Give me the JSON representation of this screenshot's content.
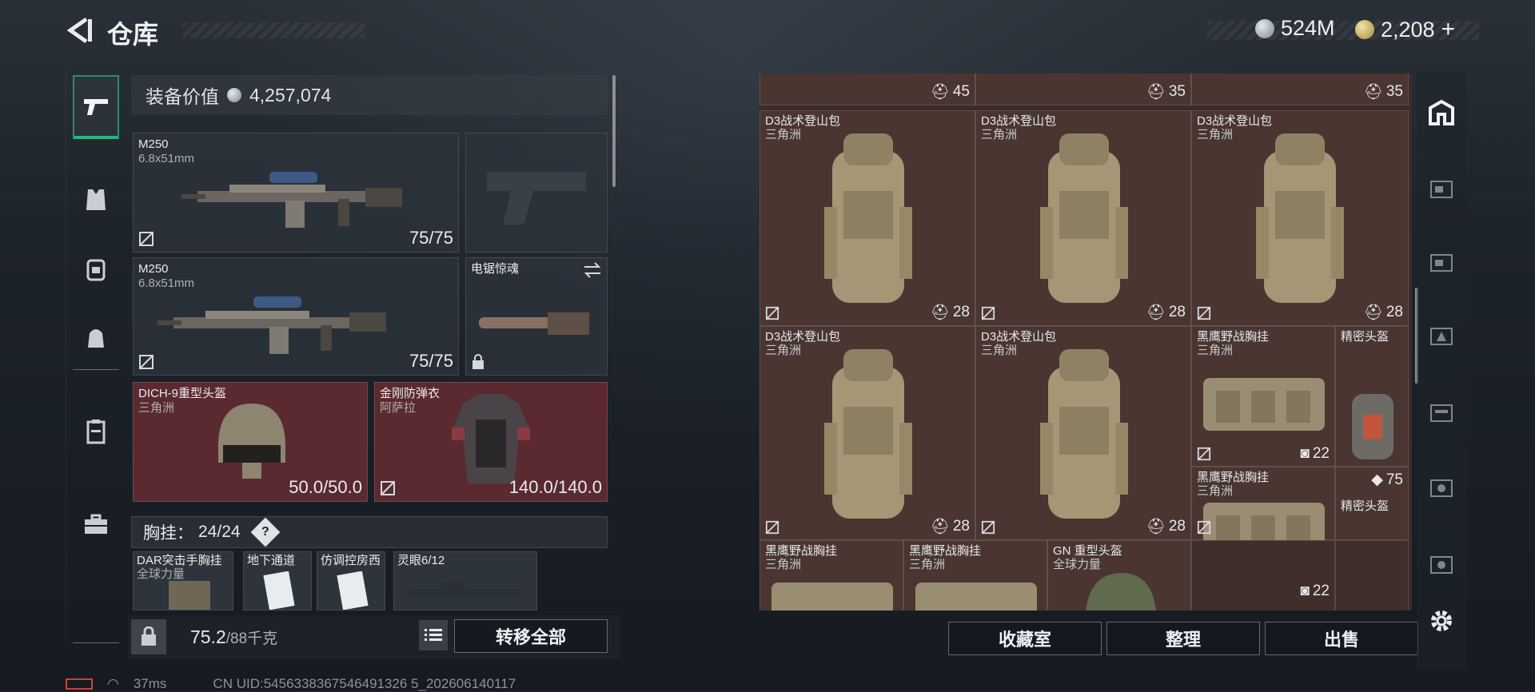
{
  "header": {
    "title": "仓库",
    "currency1": "524M",
    "currency2": "2,208"
  },
  "left_nav": {
    "items": [
      "weapon",
      "vest",
      "backpack",
      "bag",
      "armor",
      "toolbox"
    ],
    "active": "weapon"
  },
  "equipment": {
    "value_label": "装备价值",
    "value": "4,257,074",
    "primary1": {
      "name": "M250",
      "caliber": "6.8x51mm",
      "durability": "75/75"
    },
    "primary2": {
      "name": "M250",
      "caliber": "6.8x51mm",
      "durability": "75/75"
    },
    "melee": {
      "name": "电锯惊魂"
    },
    "helmet": {
      "name": "DICH-9重型头盔",
      "origin": "三角洲",
      "durability": "50.0/50.0"
    },
    "armor": {
      "name": "金刚防弹衣",
      "origin": "阿萨拉",
      "durability": "140.0/140.0"
    },
    "chest": {
      "label": "胸挂：",
      "count": "24/24",
      "help": "?"
    },
    "minis": [
      {
        "name": "DAR突击手胸挂",
        "sub": "全球力量"
      },
      {
        "name": "地下通道",
        "sub": ""
      },
      {
        "name": "仿调控房西",
        "sub": ""
      },
      {
        "name": "灵眼6/12",
        "sub": ""
      }
    ],
    "weight": "75.2",
    "weight_max": "/88千克",
    "transfer_all": "转移全部"
  },
  "status": {
    "ping": "37ms",
    "uid": "CN UID:5456338367546491326 5_202606140117"
  },
  "storage": {
    "top_counts": [
      "45",
      "35",
      "35"
    ],
    "items": [
      {
        "name": "D3战术登山包",
        "origin": "三角洲",
        "count": "28"
      },
      {
        "name": "D3战术登山包",
        "origin": "三角洲",
        "count": "28"
      },
      {
        "name": "D3战术登山包",
        "origin": "三角洲",
        "count": "28"
      },
      {
        "name": "D3战术登山包",
        "origin": "三角洲",
        "count": "28"
      },
      {
        "name": "D3战术登山包",
        "origin": "三角洲",
        "count": "28"
      },
      {
        "name": "黑鹰野战胸挂",
        "origin": "三角洲",
        "count": "22"
      },
      {
        "name": "精密头盔",
        "origin": "",
        "count": ""
      },
      {
        "name": "黑鹰野战胸挂",
        "origin": "三角洲",
        "count": "75"
      },
      {
        "name": "精密头盔",
        "origin": "",
        "count": ""
      },
      {
        "name": "黑鹰野战胸挂",
        "origin": "三角洲",
        "count": ""
      },
      {
        "name": "黑鹰野战胸挂",
        "origin": "三角洲",
        "count": ""
      },
      {
        "name": "GN 重型头盔",
        "origin": "全球力量",
        "count": ""
      },
      {
        "name": "",
        "origin": "",
        "count": "22"
      }
    ],
    "buttons": {
      "collection": "收藏室",
      "organize": "整理",
      "sell": "出售"
    }
  },
  "colors": {
    "accent": "#33b07f",
    "slot_red": "#5a2a30",
    "storage_bg": "#4a3530"
  }
}
